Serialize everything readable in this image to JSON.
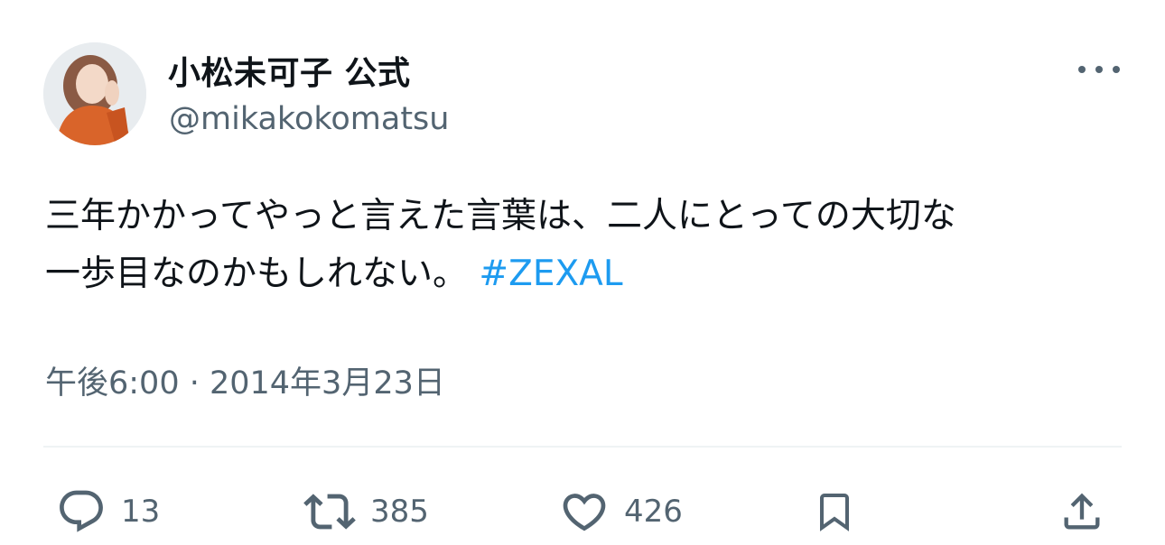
{
  "tweet": {
    "author": {
      "display_name": "小松未可子 公式",
      "handle": "@mikakokomatsu"
    },
    "text_line_1": "三年かかってやっと言えた言葉は、二人にとっての大切な",
    "text_line_2": "一歩目なのかもしれない。",
    "hashtag": "#ZEXAL",
    "timestamp": "午後6:00 · 2014年3月23日",
    "colors": {
      "link": "#1d9bf0",
      "secondary_text": "#536471",
      "primary_text": "#0f1419"
    }
  },
  "actions": {
    "reply": {
      "icon": "reply-icon",
      "count": "13"
    },
    "retweet": {
      "icon": "retweet-icon",
      "count": "385"
    },
    "like": {
      "icon": "heart-icon",
      "count": "426"
    },
    "bookmark": {
      "icon": "bookmark-icon"
    },
    "share": {
      "icon": "share-icon"
    }
  },
  "more_icon": "more-icon"
}
